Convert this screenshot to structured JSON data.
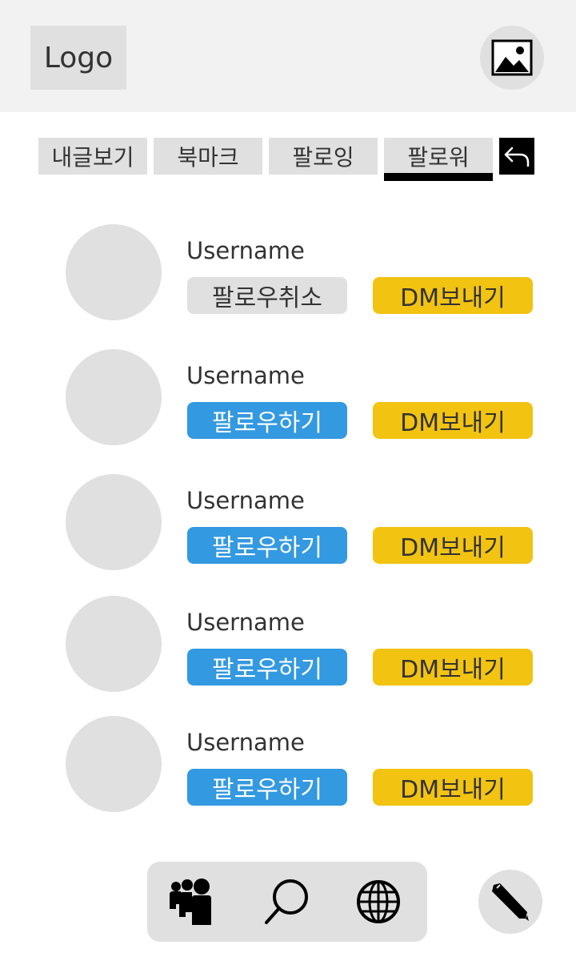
{
  "header": {
    "logo_text": "Logo",
    "profile_icon": "image-icon"
  },
  "tabs": [
    {
      "label": "내글보기"
    },
    {
      "label": "북마크"
    },
    {
      "label": "팔로잉"
    },
    {
      "label": "팔로워",
      "active": true
    }
  ],
  "back_icon": "undo-arrow-icon",
  "users": [
    {
      "username": "Username",
      "follow_label": "팔로우취소",
      "follow_state": "following",
      "dm_label": "DM보내기"
    },
    {
      "username": "Username",
      "follow_label": "팔로우하기",
      "follow_state": "not-following",
      "dm_label": "DM보내기"
    },
    {
      "username": "Username",
      "follow_label": "팔로우하기",
      "follow_state": "not-following",
      "dm_label": "DM보내기"
    },
    {
      "username": "Username",
      "follow_label": "팔로우하기",
      "follow_state": "not-following",
      "dm_label": "DM보내기"
    },
    {
      "username": "Username",
      "follow_label": "팔로우하기",
      "follow_state": "not-following",
      "dm_label": "DM보내기"
    }
  ],
  "bottom_nav": {
    "items": [
      {
        "icon": "people-icon"
      },
      {
        "icon": "search-icon"
      },
      {
        "icon": "globe-icon"
      }
    ],
    "write_icon": "pencil-icon"
  },
  "colors": {
    "follow_button": "#3399e0",
    "unfollow_button": "#e0e0e0",
    "dm_button": "#f2c311",
    "placeholder_gray": "#e0e0e0",
    "header_bg": "#f2f2f2"
  }
}
